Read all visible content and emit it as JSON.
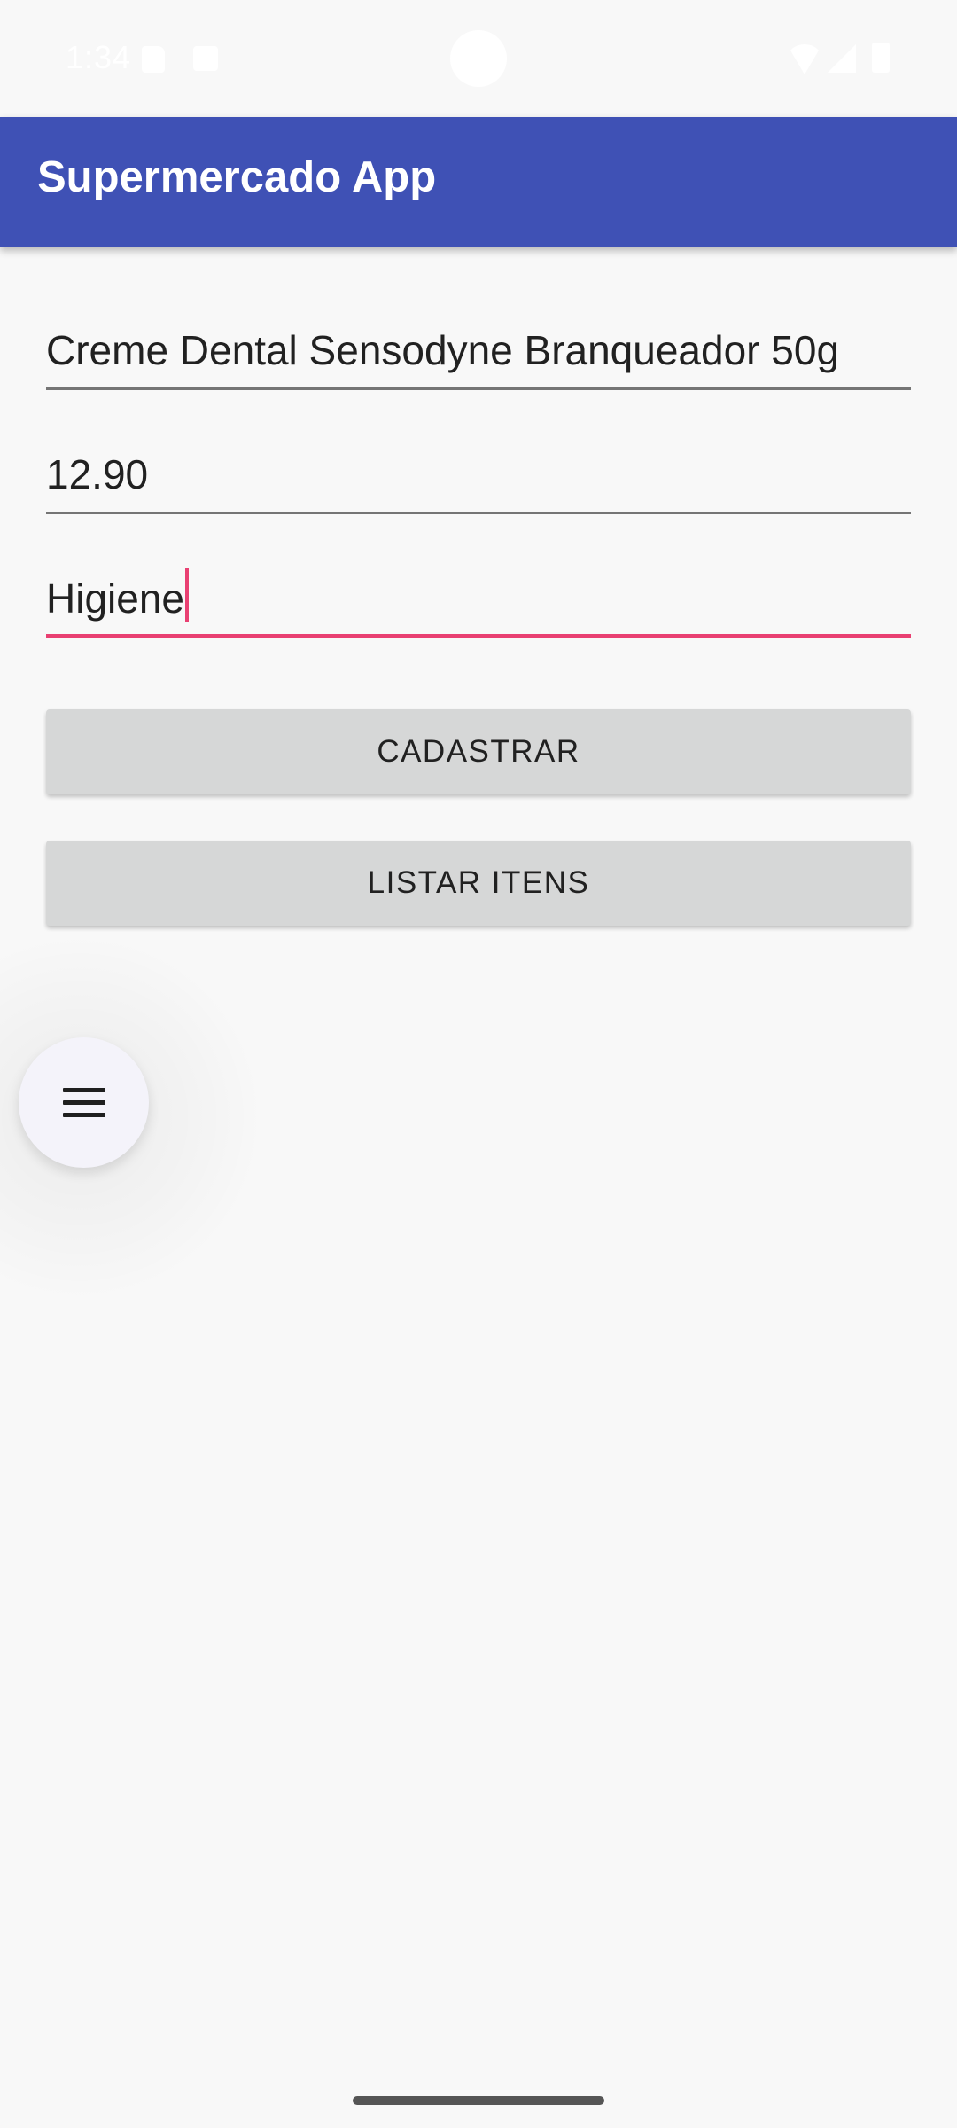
{
  "status_bar": {
    "time": "1:34"
  },
  "app_bar": {
    "title": "Supermercado App"
  },
  "form": {
    "product_name": "Creme Dental Sensodyne Branqueador 50g",
    "price": "12.90",
    "category": "Higiene"
  },
  "buttons": {
    "register_label": "CADASTRAR",
    "list_label": "LISTAR ITENS"
  },
  "fab": {
    "icon": "menu-icon"
  },
  "colors": {
    "app_bar": "#3f51b5",
    "accent": "#e94072",
    "button": "#d6d7d7",
    "background": "#f8f8f8"
  }
}
